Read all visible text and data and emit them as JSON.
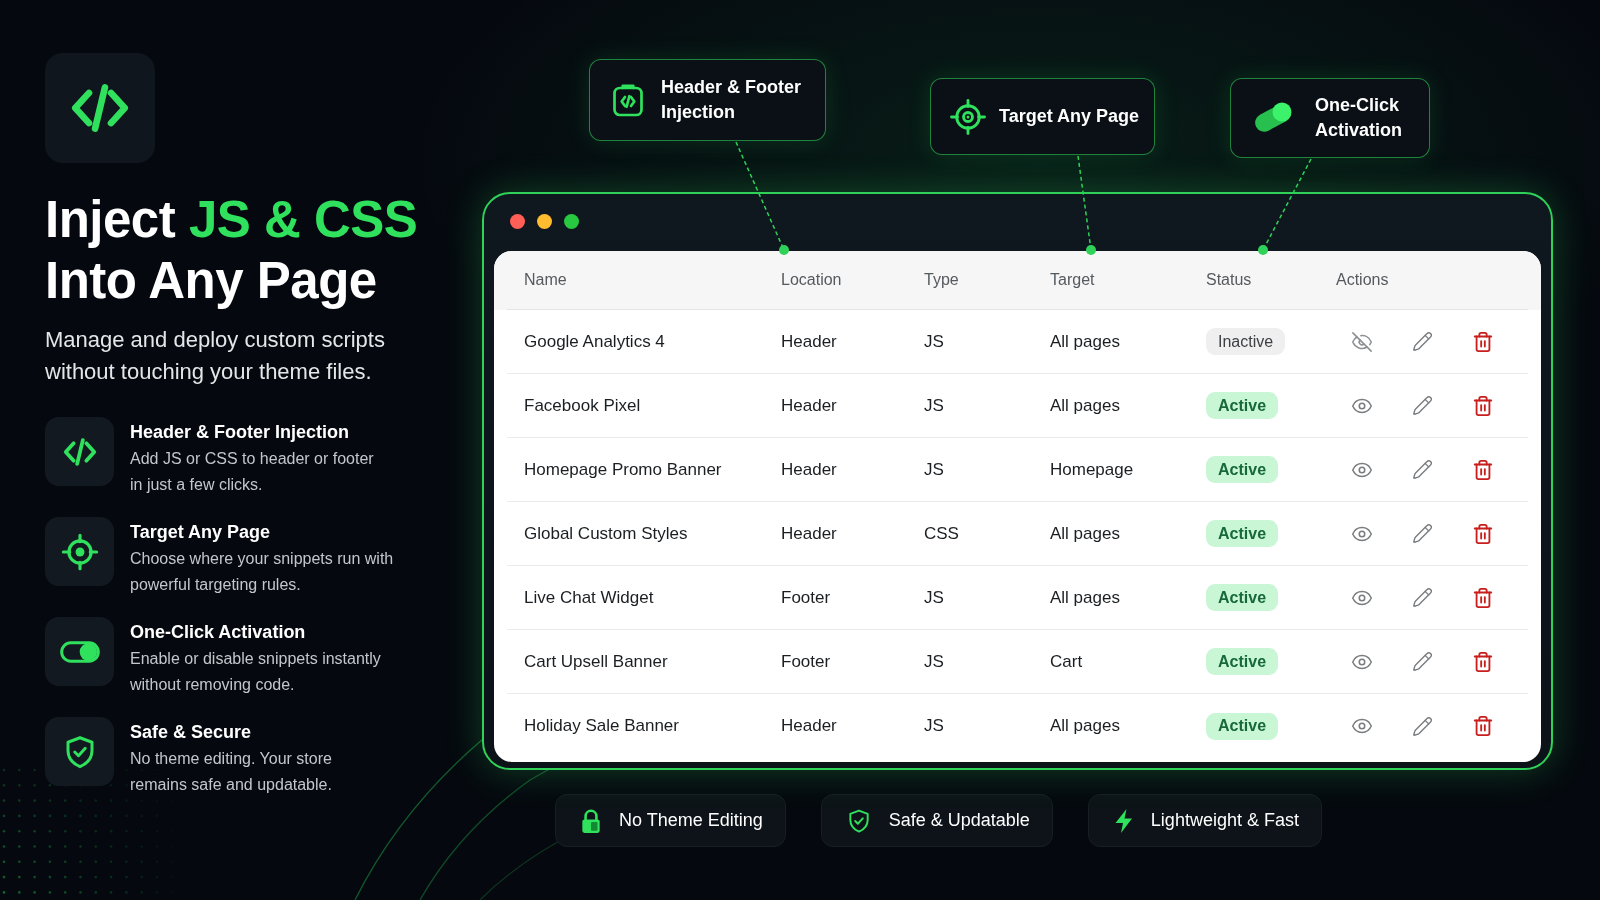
{
  "hero": {
    "title": {
      "lead": "Inject",
      "highlight": "JS & CSS",
      "rest": "Into Any Page"
    },
    "subtitle_lines": [
      "Manage and deploy custom scripts",
      "without touching your theme files."
    ]
  },
  "features": [
    {
      "title": "Header & Footer Injection",
      "description_lines": [
        "Add JS or CSS to header or footer",
        "in just a few clicks."
      ]
    },
    {
      "title": "Target Any Page",
      "description_lines": [
        "Choose where your snippets run with",
        "powerful targeting rules."
      ]
    },
    {
      "title": "One-Click Activation",
      "description_lines": [
        "Enable or disable snippets instantly",
        "without removing code."
      ]
    },
    {
      "title": "Safe & Secure",
      "description_lines": [
        "No theme editing. Your store",
        "remains safe and updatable."
      ]
    }
  ],
  "callouts": [
    {
      "label_lines": [
        "Header & Footer",
        "Injection"
      ]
    },
    {
      "label_lines": [
        "Target Any Page"
      ]
    },
    {
      "label_lines": [
        "One-Click",
        "Activation"
      ]
    }
  ],
  "table": {
    "columns": [
      "Name",
      "Location",
      "Type",
      "Target",
      "Status",
      "Actions"
    ],
    "rows": [
      {
        "name": "Google Analytics 4",
        "location": "Header",
        "type": "JS",
        "target": "All pages",
        "status": "Inactive",
        "active": false
      },
      {
        "name": "Facebook Pixel",
        "location": "Header",
        "type": "JS",
        "target": "All pages",
        "status": "Active",
        "active": true
      },
      {
        "name": "Homepage Promo Banner",
        "location": "Header",
        "type": "JS",
        "target": "Homepage",
        "status": "Active",
        "active": true
      },
      {
        "name": "Global Custom Styles",
        "location": "Header",
        "type": "CSS",
        "target": "All pages",
        "status": "Active",
        "active": true
      },
      {
        "name": "Live Chat Widget",
        "location": "Footer",
        "type": "JS",
        "target": "All pages",
        "status": "Active",
        "active": true
      },
      {
        "name": "Cart Upsell Banner",
        "location": "Footer",
        "type": "JS",
        "target": "Cart",
        "status": "Active",
        "active": true
      },
      {
        "name": "Holiday Sale Banner",
        "location": "Header",
        "type": "JS",
        "target": "All pages",
        "status": "Active",
        "active": true
      }
    ]
  },
  "badges": [
    {
      "label": "No Theme Editing"
    },
    {
      "label": "Safe & Updatable"
    },
    {
      "label": "Lightweight & Fast"
    }
  ]
}
